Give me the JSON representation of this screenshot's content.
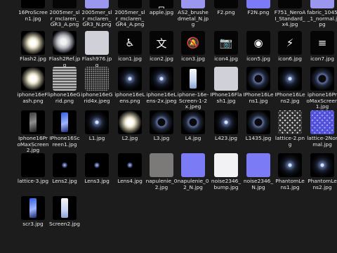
{
  "files": [
    {
      "name": "16ProScreen1.jpg",
      "thumb": "dark"
    },
    {
      "name": "2005mer_slr_mclaren_GR3_A.png",
      "thumb": "black"
    },
    {
      "name": "2005mer_slr_mclaren_GR3_N.png",
      "thumb": "lav"
    },
    {
      "name": "2005mer_slr_mclaren_GR4_A.png",
      "thumb": "black"
    },
    {
      "name": "apple.jpg",
      "thumb": "apple"
    },
    {
      "name": "AS2_brushedmetal_N.jpg",
      "thumb": "lav"
    },
    {
      "name": "F2.png",
      "thumb": "black"
    },
    {
      "name": "F2N.png",
      "thumb": "blue"
    },
    {
      "name": "F751_NeroAI_Standard_x4.jpg",
      "thumb": "black"
    },
    {
      "name": "fabric_1045_1_normal.jpg",
      "thumb": "lav"
    },
    {
      "name": "Flash2.jpg",
      "thumb": "flash"
    },
    {
      "name": "Flash2Ref.jpg",
      "thumb": "orb"
    },
    {
      "name": "Flash976.jpg",
      "thumb": "light"
    },
    {
      "name": "icon1.jpg",
      "thumb": "accessibility-icon"
    },
    {
      "name": "icon2.jpg",
      "thumb": "translate-icon"
    },
    {
      "name": "icon3.jpg",
      "thumb": "bell-off-icon"
    },
    {
      "name": "icon4.jpg",
      "thumb": "camera-icon"
    },
    {
      "name": "icon5.jpg",
      "thumb": "record-icon"
    },
    {
      "name": "icon6.jpg",
      "thumb": "flashlight-icon"
    },
    {
      "name": "icon7.jpg",
      "thumb": "waveform-icon"
    },
    {
      "name": "iphone16eFlash.png",
      "thumb": "flash"
    },
    {
      "name": "iphone16eGrid.png",
      "thumb": "grid"
    },
    {
      "name": "iphone16eGrid4x.jpeg",
      "thumb": "gridfine"
    },
    {
      "name": "iphone16eLens.png",
      "thumb": "lens"
    },
    {
      "name": "iphone16eLens-2x.jpeg",
      "thumb": "lens"
    },
    {
      "name": "iphone-16e-Screen-1-2x.jpeg",
      "thumb": "phone-white"
    },
    {
      "name": "IPhone16Flash1.jpg",
      "thumb": "light"
    },
    {
      "name": "IPhone16Lens1.jpg",
      "thumb": "lensring"
    },
    {
      "name": "IPhone16Lens2.jpg",
      "thumb": "lens"
    },
    {
      "name": "iphone16ProMaxScreen1.jpg",
      "thumb": "lensring"
    },
    {
      "name": "Iphone16ProMaxScreen2.jpg",
      "thumb": "phone-dark"
    },
    {
      "name": "IPhone16Screen1.jpg",
      "thumb": "phone-blue"
    },
    {
      "name": "L1.jpg",
      "thumb": "lens"
    },
    {
      "name": "L2.jpg",
      "thumb": "flash"
    },
    {
      "name": "L3.jpg",
      "thumb": "lensring"
    },
    {
      "name": "L4.jpg",
      "thumb": "lensring"
    },
    {
      "name": "L423.jpg",
      "thumb": "lens"
    },
    {
      "name": "L1435.jpg",
      "thumb": "lensring"
    },
    {
      "name": "lattice-2.png",
      "thumb": "lattice"
    },
    {
      "name": "lattice-2Normal.jpg",
      "thumb": "latticen"
    },
    {
      "name": "lattice-3.jpg",
      "thumb": "dark"
    },
    {
      "name": "Lens2.jpg",
      "thumb": "lensdots"
    },
    {
      "name": "Lens3.jpg",
      "thumb": "lensdots"
    },
    {
      "name": "Lens4.jpg",
      "thumb": "lensdots"
    },
    {
      "name": "napulenie_02.jpg",
      "thumb": "gray"
    },
    {
      "name": "napulenie_02_N.jpg",
      "thumb": "blue"
    },
    {
      "name": "noise2346_bump.jpg",
      "thumb": "white"
    },
    {
      "name": "noise2346_N.jpg",
      "thumb": "blue"
    },
    {
      "name": "PhantomLens1.jpg",
      "thumb": "lens"
    },
    {
      "name": "PhantomLens2.jpg",
      "thumb": "lens"
    },
    {
      "name": "scr3.jpg",
      "thumb": "phone-blue"
    },
    {
      "name": "Screen2.jpg",
      "thumb": "phone-white"
    }
  ]
}
